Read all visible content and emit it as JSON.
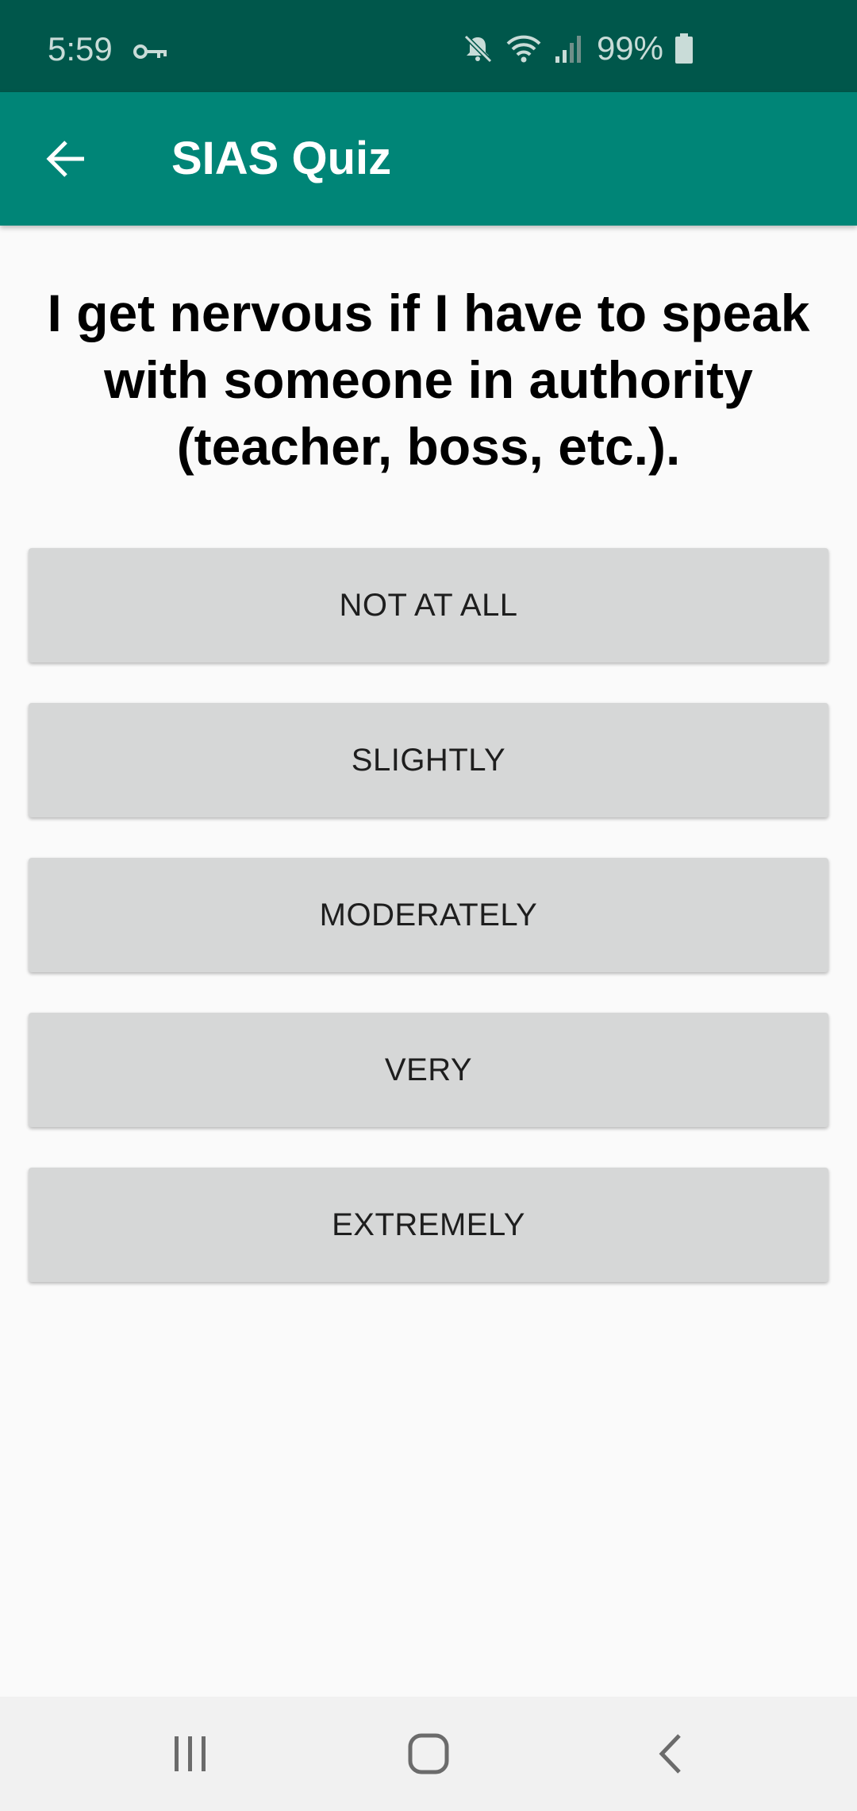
{
  "status_bar": {
    "time": "5:59",
    "battery": "99%",
    "icons": [
      "vpn-key-icon",
      "mute-icon",
      "wifi-icon",
      "signal-icon",
      "battery-icon"
    ],
    "color": "#00574b"
  },
  "app_bar": {
    "title": "SIAS Quiz",
    "back_icon": "arrow-back-icon",
    "color": "#008577"
  },
  "question": {
    "text": "I get nervous if I have to speak with someone in authority (teacher, boss, etc.)."
  },
  "answers": [
    {
      "label": "NOT AT ALL"
    },
    {
      "label": "SLIGHTLY"
    },
    {
      "label": "MODERATELY"
    },
    {
      "label": "VERY"
    },
    {
      "label": "EXTREMELY"
    }
  ],
  "nav_bar": {
    "icons": [
      "recent-apps-icon",
      "home-icon",
      "back-nav-icon"
    ]
  }
}
